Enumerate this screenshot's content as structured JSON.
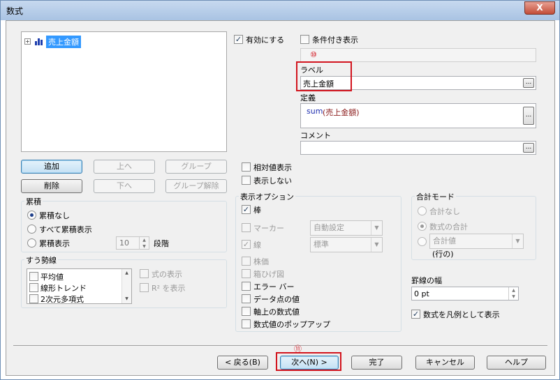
{
  "window": {
    "title": "数式",
    "close_glyph": "X"
  },
  "tree": {
    "expander": "+",
    "root_label": "売上金額"
  },
  "left_buttons": {
    "add": "追加",
    "up": "上へ",
    "group": "グループ",
    "delete": "削除",
    "down": "下へ",
    "ungroup": "グループ解除"
  },
  "accumulation": {
    "legend": "累積",
    "none": "累積なし",
    "all": "すべて累積表示",
    "show": "累積表示",
    "steps_value": "10",
    "steps_label": "段階"
  },
  "trendline": {
    "legend": "すう勢線",
    "items": [
      "平均値",
      "線形トレンド",
      "2次元多項式"
    ],
    "show_formula": "式の表示",
    "show_r2": "R² を表示"
  },
  "top": {
    "enable": "有効にする",
    "conditional": "条件付き表示",
    "marker10": "⑩",
    "label_caption": "ラベル",
    "label_value": "売上金額",
    "definition_caption": "定義",
    "definition_func": "sum",
    "definition_arg": "(売上金額)",
    "comment_caption": "コメント",
    "ellipsis": "..."
  },
  "relative": "相対値表示",
  "hide": "表示しない",
  "display_options": {
    "legend": "表示オプション",
    "bar": "棒",
    "marker": "マーカー",
    "marker_combo": "自動設定",
    "line": "線",
    "line_combo": "標準",
    "stock": "株価",
    "box": "箱ひげ図",
    "error_bar": "エラー バー",
    "data_value": "データ点の値",
    "axis_formula": "軸上の数式値",
    "popup": "数式値のポップアップ"
  },
  "total_mode": {
    "legend": "合計モード",
    "none": "合計なし",
    "formula_total": "数式の合計",
    "total_value_combo": "合計値",
    "row_suffix": "(行の)"
  },
  "line_width": {
    "caption": "罫線の幅",
    "value": "0 pt"
  },
  "show_as_legend": "数式を凡例として表示",
  "footer": {
    "marker11": "⑪",
    "back": "< 戻る(B)",
    "next": "次へ(N) >",
    "finish": "完了",
    "cancel": "キャンセル",
    "help": "ヘルプ"
  }
}
